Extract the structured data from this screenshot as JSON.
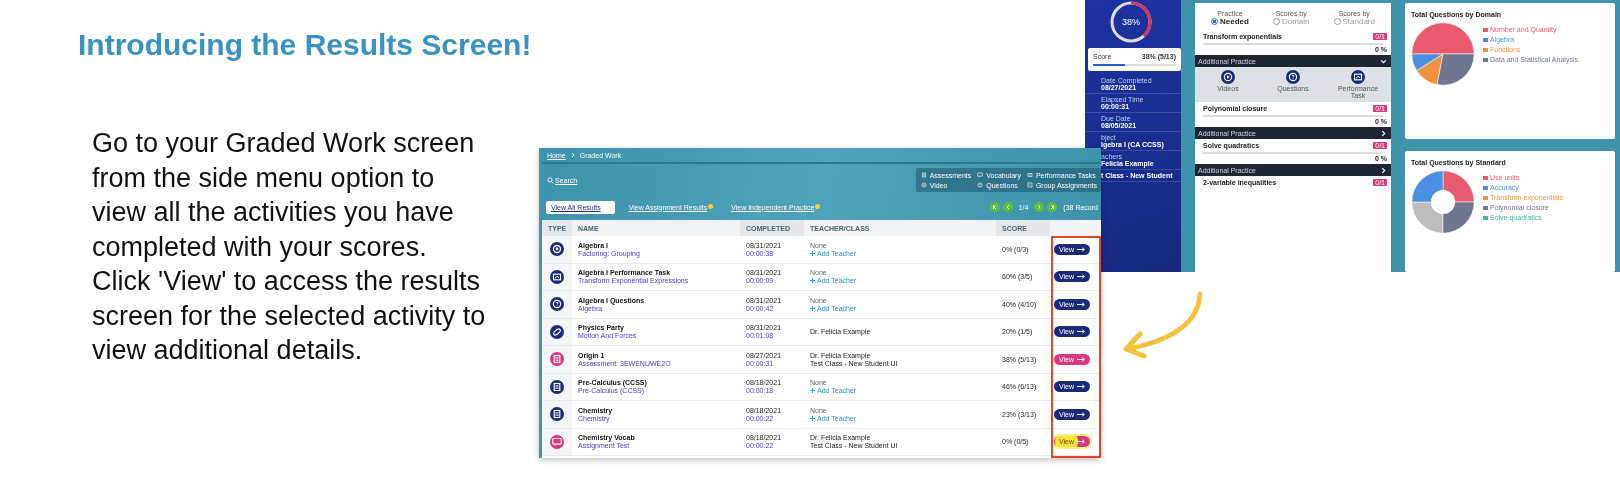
{
  "heading": "Introducing the Results Screen!",
  "description": "Go to your Graded Work screen from the side menu option to view all the activities you have completed with your scores. Click 'View' to access the results screen for the selected activity to view additional details.",
  "graded_work": {
    "breadcrumb": [
      "Home",
      "Graded Work"
    ],
    "search": {
      "label": "Search"
    },
    "legend": [
      {
        "label": "Assessments",
        "kind": "assessment"
      },
      {
        "label": "Vocabulary",
        "kind": "vocabulary"
      },
      {
        "label": "Performance Tasks",
        "kind": "task"
      },
      {
        "label": "Video",
        "kind": "video"
      },
      {
        "label": "Questions",
        "kind": "questions"
      },
      {
        "label": "Group Assignments",
        "kind": "group"
      }
    ],
    "tabs": [
      {
        "label": "View All Results",
        "selected": true,
        "badge": false
      },
      {
        "label": "View Assignment Results",
        "selected": false,
        "badge": true
      },
      {
        "label": "View Independent Practice",
        "selected": false,
        "badge": true
      }
    ],
    "pagination": {
      "page": "1/4",
      "records": "(38 Record"
    },
    "columns": [
      "TYPE",
      "NAME",
      "COMPLETED",
      "TEACHER/CLASS",
      "SCORE"
    ],
    "rows": [
      {
        "kind": "skill",
        "color": "#1c2b78",
        "name": "Algebra I",
        "subtitle": "Factoring: Grouping",
        "date": "08/31/2021",
        "time": "00:00:38",
        "teacher": [
          "None"
        ],
        "add_teacher": "Add Teacher",
        "score": "0% (0/3)",
        "action": "View",
        "highlighted": false
      },
      {
        "kind": "task",
        "color": "#1c2b78",
        "name": "Algebra I Performance Task",
        "subtitle": "Transform Exponential Expressions",
        "date": "08/31/2021",
        "time": "00:00:09",
        "teacher": [
          "None"
        ],
        "add_teacher": "Add Teacher",
        "score": "60% (3/5)",
        "action": "View",
        "highlighted": false
      },
      {
        "kind": "questions",
        "color": "#1c2b78",
        "name": "Algebra I Questions",
        "subtitle": "Algebra",
        "date": "08/31/2021",
        "time": "00:00:42",
        "teacher": [
          "None"
        ],
        "add_teacher": "Add Teacher",
        "score": "40% (4/10)",
        "action": "View",
        "highlighted": false
      },
      {
        "kind": "lesson",
        "color": "#1c2b78",
        "name": "Physics Party",
        "subtitle": "Motion And Forces",
        "date": "08/31/2021",
        "time": "00:01:08",
        "teacher": [
          "Dr. Felicia Example"
        ],
        "score": "20% (1/5)",
        "action": "View",
        "highlighted": false
      },
      {
        "kind": "assessment",
        "color": "#d9387f",
        "name": "Origin 1",
        "subtitle": "Assessment: 3EWENUWE2O",
        "date": "08/27/2021",
        "time": "00:00:31",
        "teacher": [
          "Dr. Felicia Example",
          "Test Class - New Student UI"
        ],
        "score": "38% (5/13)",
        "action": "View",
        "highlighted": false
      },
      {
        "kind": "assessment",
        "color": "#1c2b78",
        "name": "Pre-Calculus (CCSS)",
        "subtitle": "Pre-Calculus (CCSS)",
        "date": "08/18/2021",
        "time": "00:00:18",
        "teacher": [
          "None"
        ],
        "add_teacher": "Add Teacher",
        "score": "46% (6/13)",
        "action": "View",
        "highlighted": false
      },
      {
        "kind": "assessment",
        "color": "#1c2b78",
        "name": "Chemistry",
        "subtitle": "Chemistry",
        "date": "08/18/2021",
        "time": "00:00:22",
        "teacher": [
          "None"
        ],
        "add_teacher": "Add Teacher",
        "score": "23% (3/13)",
        "action": "View",
        "highlighted": false
      },
      {
        "kind": "vocab",
        "color": "#d9387f",
        "name": "Chemistry Vocab",
        "subtitle": "Assignment Test",
        "date": "08/18/2021",
        "time": "00:00:22",
        "teacher": [
          "Dr. Felicia Example",
          "Test Class - New Student UI"
        ],
        "score": "0% (0/5)",
        "action": "View",
        "highlighted": true
      }
    ]
  },
  "results": {
    "ring": {
      "label": "38%"
    },
    "score": {
      "label": "Score",
      "value": "38% (5/13)",
      "level": 0.38
    },
    "details": [
      {
        "label": "Date Completed",
        "value": "08/27/2021"
      },
      {
        "label": "Elapsed Time",
        "value": "00:00:31"
      },
      {
        "label": "Due Date",
        "value": "08/05/2021"
      },
      {
        "label": "bject",
        "value": "lgebra I (CA CCSS)"
      },
      {
        "label": "achers",
        "value": "Felicia Example"
      },
      {
        "value": "t Class - New Student"
      }
    ],
    "views": [
      {
        "top": "Practice",
        "bottom": "Needed",
        "selected": true
      },
      {
        "top": "Scores by",
        "bottom": "Domain",
        "selected": false
      },
      {
        "top": "Scores by",
        "bottom": "Standard",
        "selected": false
      }
    ],
    "skills": [
      {
        "name": "Transform exponentials",
        "badge": "0/1",
        "level": 0,
        "percent": "0 %",
        "practice": {
          "label": "Additional Practice",
          "expanded": true,
          "items": [
            {
              "label": "Videos",
              "kind": "video"
            },
            {
              "label": "Questions",
              "kind": "questions"
            },
            {
              "label": "Performance Task",
              "kind": "task"
            }
          ]
        }
      },
      {
        "name": "Polynomial closure",
        "badge": "0/1",
        "level": 0,
        "percent": "0 %",
        "practice": {
          "label": "Additional Practice",
          "expanded": false
        }
      },
      {
        "name": "Solve quadratics",
        "badge": "0/1",
        "level": 0,
        "percent": "0 %",
        "practice": {
          "label": "Additional Practice",
          "expanded": false
        }
      },
      {
        "name": "2-variable inequalities",
        "badge": "0/1"
      }
    ],
    "domain_chart": {
      "title": "Total Questions by Domain",
      "legend": [
        {
          "label": "Number and Quantity",
          "color": "#e85a6e"
        },
        {
          "label": "Algebra",
          "color": "#4a8fe0"
        },
        {
          "label": "Functions",
          "color": "#f0913e"
        },
        {
          "label": "Data and Statistical Analysis",
          "color": "#6f7690"
        }
      ]
    },
    "standard_chart": {
      "title": "Total Questions by Standard",
      "legend": [
        {
          "label": "Use units",
          "color": "#e85a6e"
        },
        {
          "label": "Accuracy",
          "color": "#4a8fe0"
        },
        {
          "label": "Transform exponentials",
          "color": "#f0913e"
        },
        {
          "label": "Polynomial closure",
          "color": "#6f7690"
        },
        {
          "label": "Solve quadratics",
          "color": "#3fb3a0"
        }
      ]
    }
  }
}
